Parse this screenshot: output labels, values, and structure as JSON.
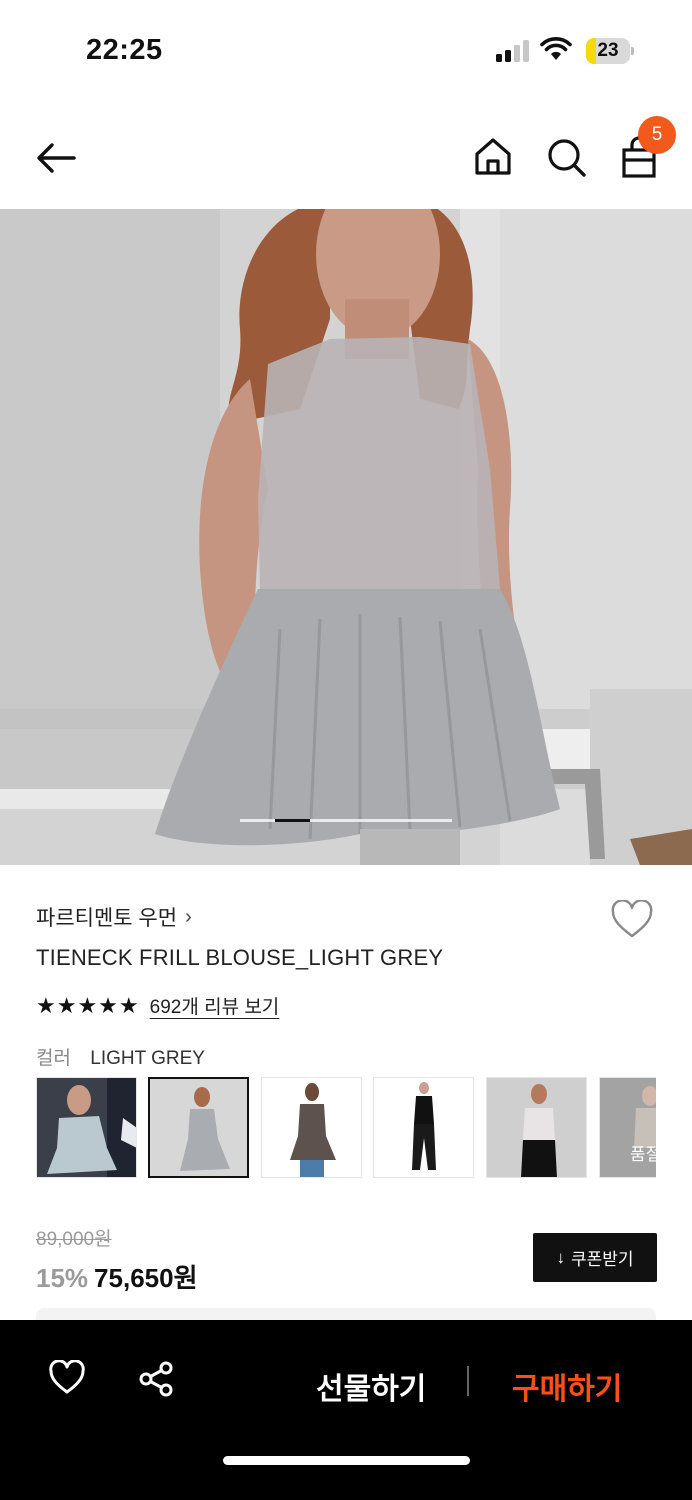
{
  "status_bar": {
    "time": "22:25",
    "battery": "23",
    "battery_level": 0.23
  },
  "nav": {
    "cart_count": "5",
    "icons": [
      "back-arrow-icon",
      "home-icon",
      "search-icon",
      "shopping-bag-icon"
    ]
  },
  "product": {
    "brand": "파르티멘토 우먼",
    "brand_chevron": "›",
    "name": "TIENECK FRILL BLOUSE_LIGHT GREY",
    "stars": "★★★★★",
    "review_link": "692개 리뷰 보기",
    "color_label": "컬러",
    "color_value": "LIGHT GREY",
    "thumb_overflow_text": "품절",
    "original_price": "89,000원",
    "discount": "15%",
    "final_price": "75,650원",
    "coupon_icon": "↓",
    "coupon_label": "쿠폰받기"
  },
  "bottom_bar": {
    "gift_label": "선물하기",
    "buy_label": "구매하기"
  },
  "colors": {
    "accent": "#f25a1c",
    "buy": "#ff4f14",
    "bar_bg": "#000000"
  }
}
